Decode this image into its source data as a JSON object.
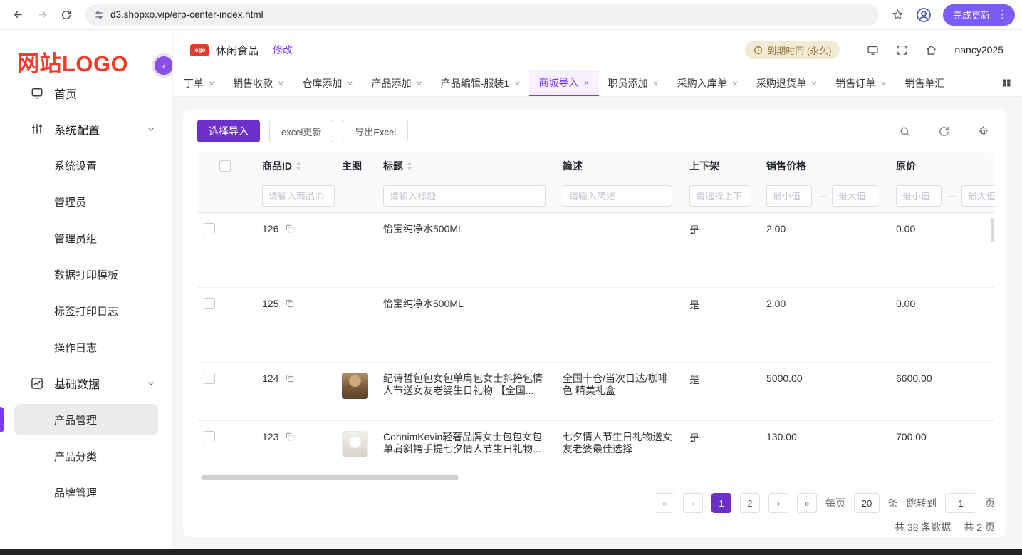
{
  "browser": {
    "url": "d3.shopxo.vip/erp-center-index.html",
    "update_label": "完成更新"
  },
  "icons": {
    "close": "×",
    "dash": "—",
    "kebab": "⋮",
    "first": "«",
    "prev": "‹",
    "next": "›",
    "last": "»",
    "collapse": "‹"
  },
  "sidebar": {
    "logo": "网站LOGO",
    "items": [
      {
        "label": "首页"
      },
      {
        "label": "系统配置"
      },
      {
        "label": "系统设置"
      },
      {
        "label": "管理员"
      },
      {
        "label": "管理员组"
      },
      {
        "label": "数据打印模板"
      },
      {
        "label": "标签打印日志"
      },
      {
        "label": "操作日志"
      },
      {
        "label": "基础数据"
      },
      {
        "label": "产品管理"
      },
      {
        "label": "产品分类"
      },
      {
        "label": "品牌管理"
      }
    ]
  },
  "header": {
    "logo_badge": "logo",
    "store_name": "休闲食品",
    "edit_label": "修改",
    "expire_badge": "到期时间 (永久)",
    "username": "nancy2025"
  },
  "tabs": [
    {
      "label": "丁单"
    },
    {
      "label": "销售收款"
    },
    {
      "label": "仓库添加"
    },
    {
      "label": "产品添加"
    },
    {
      "label": "产品编辑-服装1"
    },
    {
      "label": "商城导入"
    },
    {
      "label": "职员添加"
    },
    {
      "label": "采购入库单"
    },
    {
      "label": "采购退货单"
    },
    {
      "label": "销售订单"
    },
    {
      "label": "销售单汇"
    }
  ],
  "toolbar": {
    "import_label": "选择导入",
    "excel_update_label": "excel更新",
    "export_label": "导出Excel"
  },
  "table": {
    "columns": [
      {
        "label": "商品ID",
        "placeholder": "请输入商品ID"
      },
      {
        "label": "主图"
      },
      {
        "label": "标题",
        "placeholder": "请输入标题"
      },
      {
        "label": "简述",
        "placeholder": "请输入简述"
      },
      {
        "label": "上下架",
        "placeholder": "请选择上下架"
      },
      {
        "label": "销售价格",
        "min_placeholder": "最小值",
        "max_placeholder": "最大值"
      },
      {
        "label": "原价",
        "min_placeholder": "最小值",
        "max_placeholder": "最大值"
      }
    ],
    "rows": [
      {
        "id": "126",
        "title": "怡宝纯净水500ML",
        "desc": "",
        "on_sale": "是",
        "price": "2.00",
        "original_price": "0.00"
      },
      {
        "id": "125",
        "title": "怡宝纯净水500ML",
        "desc": "",
        "on_sale": "是",
        "price": "2.00",
        "original_price": "0.00"
      },
      {
        "id": "124",
        "title": "纪诗哲包包女包单肩包女士斜挎包情人节送女友老婆生日礼物 【全国...",
        "desc": "全国十仓/当次日达/咖啡色 精美礼盒",
        "on_sale": "是",
        "price": "5000.00",
        "original_price": "6600.00"
      },
      {
        "id": "123",
        "title": "CohnimKevin轻奢品牌女士包包女包单肩斜挎手提七夕情人节生日礼物...",
        "desc": "七夕情人节生日礼物送女友老婆最佳选择",
        "on_sale": "是",
        "price": "130.00",
        "original_price": "700.00"
      }
    ]
  },
  "pagination": {
    "pages": [
      "1",
      "2"
    ],
    "active_page": "1",
    "per_page_prefix": "每页",
    "per_page_value": "20",
    "per_page_suffix": "条",
    "jump_prefix": "跳转到",
    "jump_value": "1",
    "jump_suffix": "页",
    "total_text": "共 38 条数据",
    "total_pages_text": "共 2 页"
  },
  "colors": {
    "accent_purple": "#7c3aed",
    "button_purple": "#6d2fc9",
    "logo_red": "#f43b2a",
    "badge_bg": "#f2ead5",
    "badge_text": "#8f763a",
    "update_pill": "#7b5cf7"
  }
}
